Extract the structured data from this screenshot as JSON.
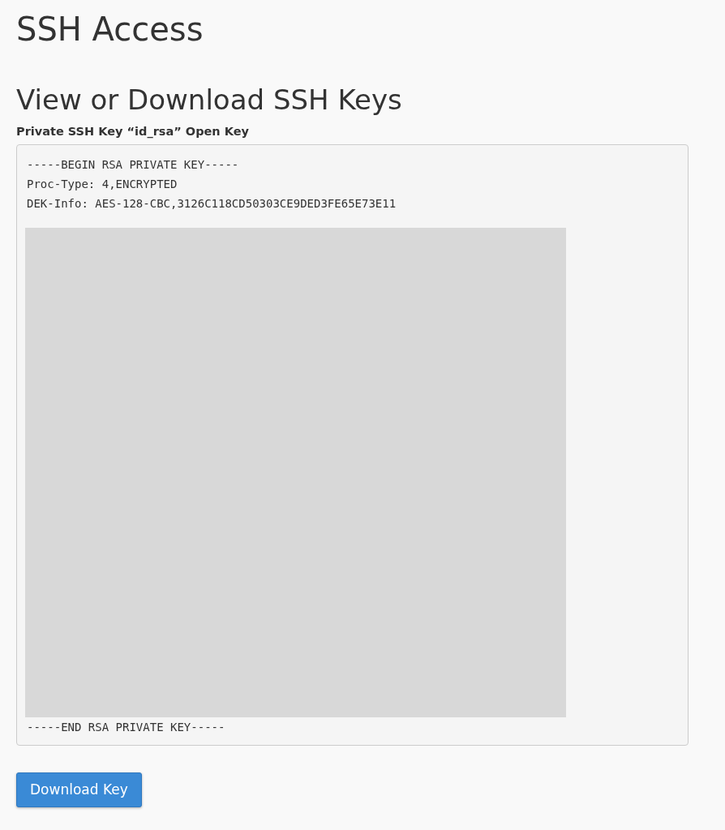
{
  "page_title": "SSH Access",
  "section_title": "View or Download SSH Keys",
  "key_label": "Private SSH Key “id_rsa” Open Key",
  "key_header_lines": [
    "-----BEGIN RSA PRIVATE KEY-----",
    "Proc-Type: 4,ENCRYPTED",
    "DEK-Info: AES-128-CBC,3126C118CD50303CE9DED3FE65E73E11"
  ],
  "key_footer_line": "-----END RSA PRIVATE KEY-----",
  "buttons": [
    {
      "label": "Download Key"
    }
  ]
}
